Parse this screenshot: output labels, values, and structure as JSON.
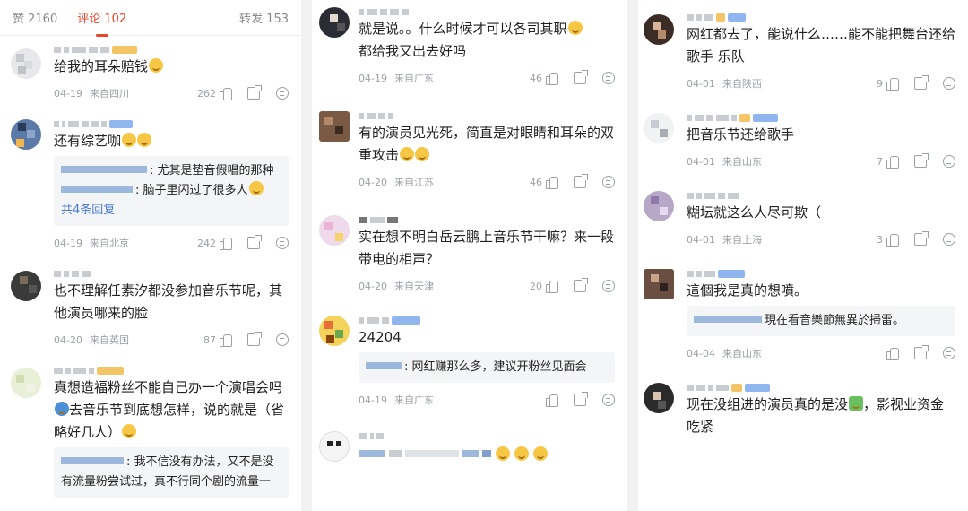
{
  "header": {
    "likes_tab": "赞 2160",
    "comments_tab": "评论 102",
    "reposts_tab": "转发 153"
  },
  "column1": [
    {
      "text": "给我的耳朵赔钱",
      "date": "04-19",
      "loc": "来自四川",
      "likes": "262"
    },
    {
      "text": "还有综艺咖",
      "quote1": ": 尤其是垫音假唱的那种",
      "quote2": ": 脑子里闪过了很多人",
      "more": "共4条回复",
      "date": "04-19",
      "loc": "来自北京",
      "likes": "242"
    },
    {
      "text": "也不理解任素汐都没参加音乐节呢，其他演员哪来的脸",
      "date": "04-20",
      "loc": "来自英国",
      "likes": "87"
    },
    {
      "text1": "真想造福粉丝不能自己办一个演唱会吗",
      "text2": "去音乐节到底想怎样，说的就是（省略好几人）",
      "quote1": ": 我不信没有办法，又不是没有流量粉尝试过，真不行同个剧的流量一"
    }
  ],
  "column2": [
    {
      "text1": "就是说。。什么时候才可以各司其职",
      "text2": "都给我又出去好吗",
      "date": "04-19",
      "loc": "来自广东",
      "likes": "46"
    },
    {
      "text": "有的演员见光死，简直是对眼睛和耳朵的双重攻击",
      "date": "04-20",
      "loc": "来自江苏",
      "likes": "46"
    },
    {
      "text": "实在想不明白岳云鹏上音乐节干嘛？来一段带电的相声？",
      "date": "04-20",
      "loc": "来自天津",
      "likes": "20"
    },
    {
      "text": "24204",
      "quote1": ": 网红赚那么多，建议开粉丝见面会",
      "date": "04-19",
      "loc": "来自广东",
      "likes": ""
    }
  ],
  "column3": [
    {
      "text": "网红都去了，能说什么……能不能把舞台还给歌手 乐队",
      "date": "04-01",
      "loc": "来自陕西",
      "likes": "9"
    },
    {
      "text": "把音乐节还给歌手",
      "date": "04-01",
      "loc": "来自山东",
      "likes": "7"
    },
    {
      "text": "糊坛就这么人尽可欺（",
      "date": "04-01",
      "loc": "来自上海",
      "likes": "3"
    },
    {
      "text": "這個我是真的想噴。",
      "quote1": "現在看音樂節無異於掃雷。",
      "date": "04-04",
      "loc": "来自山东",
      "likes": ""
    },
    {
      "text1": "现在没组进的演员真的是没",
      "text2": "，影视业资金吃紧"
    }
  ]
}
